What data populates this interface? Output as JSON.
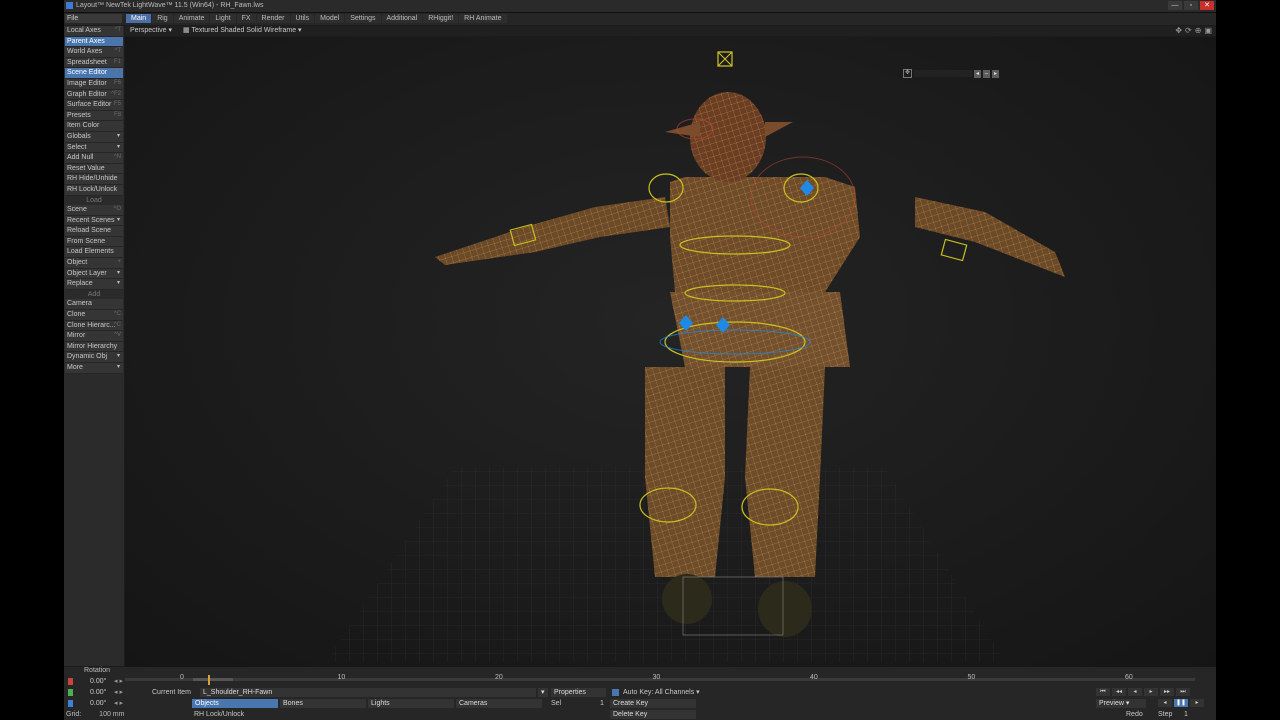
{
  "window": {
    "title": "Layout™ NewTek LightWave™ 11.5 (Win64) - RH_Fawn.lws",
    "buttons": [
      "—",
      "▫",
      "✕"
    ]
  },
  "file_menu": "File",
  "tabs": [
    "Main",
    "Rig",
    "Animate",
    "Light",
    "FX",
    "Render",
    "Utils",
    "Model",
    "Settings",
    "Additional",
    "RHiggit!",
    "RH Animate"
  ],
  "active_tab": "Main",
  "sidebar": [
    {
      "label": "Local Axes",
      "shortcut": "^T"
    },
    {
      "label": "Parent Axes",
      "shortcut": "^T",
      "selected": true
    },
    {
      "label": "World Axes",
      "shortcut": "^T"
    },
    {
      "label": "Spreadsheet",
      "shortcut": "F1"
    },
    {
      "label": "Scene Editor",
      "shortcut": "^F1",
      "selected": true
    },
    {
      "label": "Image Editor",
      "shortcut": "F6"
    },
    {
      "label": "Graph Editor",
      "shortcut": "^F2"
    },
    {
      "label": "Surface Editor",
      "shortcut": "F5"
    },
    {
      "label": "Presets",
      "shortcut": "F8"
    },
    {
      "label": "Item Color"
    },
    {
      "label": "Globals",
      "dropdown": true
    },
    {
      "label": "Select",
      "dropdown": true
    },
    {
      "label": "Add Null",
      "shortcut": "^N"
    },
    {
      "label": "Reset Value"
    },
    {
      "label": "RH Hide/Unhide"
    },
    {
      "label": "RH Lock/Unlock"
    },
    {
      "heading": "Load"
    },
    {
      "label": "Scene",
      "shortcut": "^O"
    },
    {
      "label": "Recent Scenes",
      "dropdown": true
    },
    {
      "label": "Reload Scene"
    },
    {
      "label": "From Scene"
    },
    {
      "label": "Load Elements"
    },
    {
      "label": "Object",
      "shortcut": "+"
    },
    {
      "label": "Object Layer",
      "dropdown": true
    },
    {
      "label": "Replace",
      "dropdown": true
    },
    {
      "heading": "Add"
    },
    {
      "label": "Camera"
    },
    {
      "label": "Clone",
      "shortcut": "^C"
    },
    {
      "label": "Clone Hierarc...",
      "shortcut": "^C"
    },
    {
      "label": "Mirror",
      "shortcut": "^V"
    },
    {
      "label": "Mirror Hierarchy"
    },
    {
      "label": "Dynamic Obj",
      "dropdown": true
    },
    {
      "label": "More",
      "dropdown": true
    }
  ],
  "viewport": {
    "view": "Perspective",
    "mode": "Textured Shaded Solid Wireframe"
  },
  "timeline": {
    "ticks": [
      "0",
      "10",
      "20",
      "30",
      "40",
      "50",
      "60"
    ],
    "current_frame": "0",
    "end_frame": "60"
  },
  "channels": {
    "label": "Rotation",
    "rows": [
      {
        "axis": "H",
        "value": "0.00°",
        "color": "#c8453c"
      },
      {
        "axis": "P",
        "value": "0.00°",
        "color": "#4caf50"
      },
      {
        "axis": "B",
        "value": "0.00°",
        "color": "#3f7fd6"
      }
    ],
    "grid_label": "Grid:",
    "grid_value": "100 mm"
  },
  "status": {
    "current_item_label": "Current Item",
    "current_item": "L_Shoulder_RH-Fawn",
    "objects": "Objects",
    "bones": "Bones",
    "lights": "Lights",
    "cameras": "Cameras",
    "properties": "Properties",
    "sel": "Sel",
    "sel_count": "1",
    "rh_lock": "RH Lock/Unlock",
    "auto_key": "Auto Key: All Channels",
    "create_key": "Create Key",
    "delete_key": "Delete Key",
    "preview": "Preview",
    "redo": "Redo",
    "step_label": "Step",
    "step_value": "1"
  },
  "colors": {
    "accent": "#4a76b0",
    "rig_yellow": "#c9c21e",
    "bone_blue": "#1e8ae6",
    "wire": "#d49a2e"
  }
}
